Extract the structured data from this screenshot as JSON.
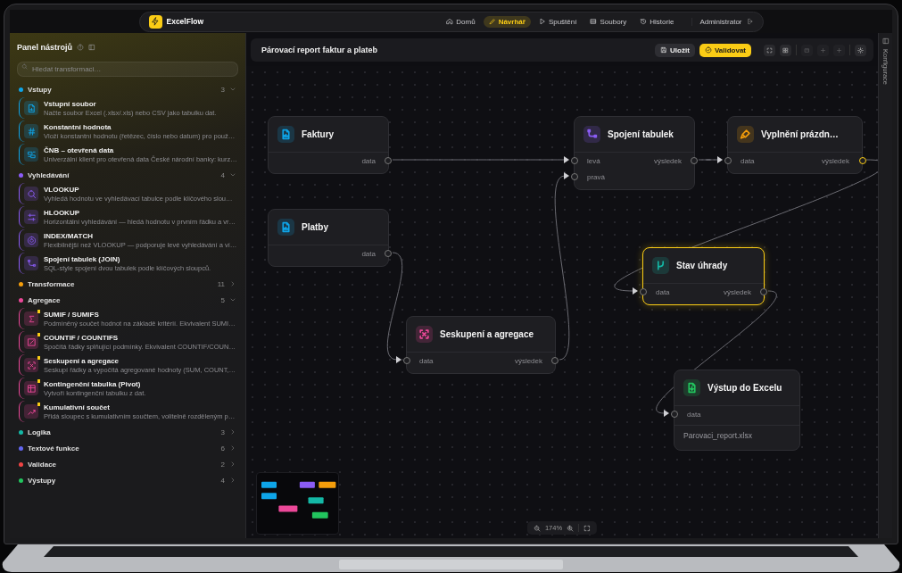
{
  "app": {
    "name": "ExcelFlow"
  },
  "nav": [
    {
      "label": "Domů",
      "kind": "home",
      "selected": false
    },
    {
      "label": "Návrhář",
      "kind": "pen",
      "selected": true
    },
    {
      "label": "Spuštění",
      "kind": "play",
      "selected": false
    },
    {
      "label": "Soubory",
      "kind": "files",
      "selected": false
    },
    {
      "label": "Historie",
      "kind": "history",
      "selected": false
    }
  ],
  "user": {
    "name": "Administrator"
  },
  "sidebar": {
    "title": "Panel nástrojů",
    "search": {
      "placeholder": "Hledat transformaci…"
    },
    "categories": [
      {
        "name": "Vstupy",
        "count": "3",
        "color": "#0ea5e9",
        "expanded": true,
        "items": [
          {
            "title": "Vstupní soubor",
            "description": "Načte soubor Excel (.xlsx/.xls) nebo CSV jako tabulku dat.",
            "kind": "file",
            "flagged": false
          },
          {
            "title": "Konstantní hodnota",
            "description": "Vloží konstantní hodnotu (řetězec, číslo nebo datum) pro použ…",
            "kind": "hash",
            "flagged": false
          },
          {
            "title": "ČNB – otevřená data",
            "description": "Univerzální klient pro otevřená data České národní banky: kurz…",
            "kind": "data",
            "flagged": false
          }
        ]
      },
      {
        "name": "Vyhledávání",
        "count": "4",
        "color": "#8b5cf6",
        "expanded": true,
        "items": [
          {
            "title": "VLOOKUP",
            "description": "Vyhledá hodnotu ve vyhledávací tabulce podle klíčového slou…",
            "kind": "search",
            "flagged": false
          },
          {
            "title": "HLOOKUP",
            "description": "Horizontální vyhledávání — hledá hodnotu v prvním řádku a vr…",
            "kind": "columns",
            "flagged": false
          },
          {
            "title": "INDEX/MATCH",
            "description": "Flexibilnější než VLOOKUP — podporuje levé vyhledávání a ví…",
            "kind": "target",
            "flagged": false
          },
          {
            "title": "Spojení tabulek (JOIN)",
            "description": "SQL-style spojení dvou tabulek podle klíčových sloupců.",
            "kind": "join",
            "flagged": false
          }
        ]
      },
      {
        "name": "Transformace",
        "count": "11",
        "color": "#f59e0b",
        "expanded": false
      },
      {
        "name": "Agregace",
        "count": "5",
        "color": "#ec4899",
        "expanded": true,
        "items": [
          {
            "title": "SUMIF / SUMIFS",
            "description": "Podmíněný součet hodnot na základě kritérií. Ekvivalent SUMI…",
            "kind": "sum",
            "flagged": true
          },
          {
            "title": "COUNTIF / COUNTIFS",
            "description": "Spočítá řádky splňující podmínky. Ekvivalent COUNTIF/COUN…",
            "kind": "count",
            "flagged": true
          },
          {
            "title": "Seskupení a agregace",
            "description": "Seskupí řádky a vypočítá agregované hodnoty (SUM, COUNT,…",
            "kind": "group",
            "flagged": true
          },
          {
            "title": "Kontingenční tabulka (Pivot)",
            "description": "Vytvoří kontingenční tabulku z dat.",
            "kind": "pivot",
            "flagged": true
          },
          {
            "title": "Kumulativní součet",
            "description": "Přidá sloupec s kumulativním součtem, volitelně rozděleným p…",
            "kind": "trend",
            "flagged": true
          }
        ]
      },
      {
        "name": "Logika",
        "count": "3",
        "color": "#14b8a6",
        "expanded": false
      },
      {
        "name": "Textové funkce",
        "count": "6",
        "color": "#6366f1",
        "expanded": false
      },
      {
        "name": "Validace",
        "count": "2",
        "color": "#ef4444",
        "expanded": false
      },
      {
        "name": "Výstupy",
        "count": "4",
        "color": "#22c55e",
        "expanded": false
      }
    ]
  },
  "toolbar": {
    "title": "Párovací report faktur a plateb",
    "buttons": [
      {
        "label": "Uložit",
        "kind": "save"
      },
      {
        "label": "Validovat",
        "kind": "validate"
      }
    ]
  },
  "canvas": {
    "nodes": [
      {
        "title": "Faktury",
        "kind": "file",
        "color": "#0ea5e9",
        "selected": false,
        "outputs": [
          {
            "label": "data",
            "active": false
          }
        ]
      },
      {
        "title": "Platby",
        "kind": "file",
        "color": "#0ea5e9",
        "selected": false,
        "outputs": [
          {
            "label": "data",
            "active": false
          }
        ]
      },
      {
        "title": "Spojení tabulek",
        "kind": "join",
        "color": "#8b5cf6",
        "selected": false,
        "inputs": [
          "levá",
          "pravá"
        ],
        "outputs": [
          {
            "label": "výsledek",
            "active": false
          }
        ]
      },
      {
        "title": "Vyplnění prázdn…",
        "kind": "brush",
        "color": "#f59e0b",
        "selected": false,
        "inputs": [
          "data"
        ],
        "outputs": [
          {
            "label": "výsledek",
            "active": true
          }
        ]
      },
      {
        "title": "Stav úhrady",
        "kind": "branch",
        "color": "#14b8a6",
        "selected": true,
        "inputs": [
          "data"
        ],
        "outputs": [
          {
            "label": "výsledek",
            "active": false
          }
        ]
      },
      {
        "title": "Seskupení a agregace",
        "kind": "group",
        "color": "#ec4899",
        "selected": false,
        "inputs": [
          "data"
        ],
        "outputs": [
          {
            "label": "výsledek",
            "active": false
          }
        ]
      },
      {
        "title": "Výstup do Excelu",
        "kind": "export",
        "color": "#22c55e",
        "selected": false,
        "inputs": [
          "data"
        ],
        "detail": "Parovaci_report.xlsx"
      }
    ],
    "zoom": {
      "reading": "174%"
    }
  },
  "config_panel": {
    "label": "Konfigurace"
  }
}
